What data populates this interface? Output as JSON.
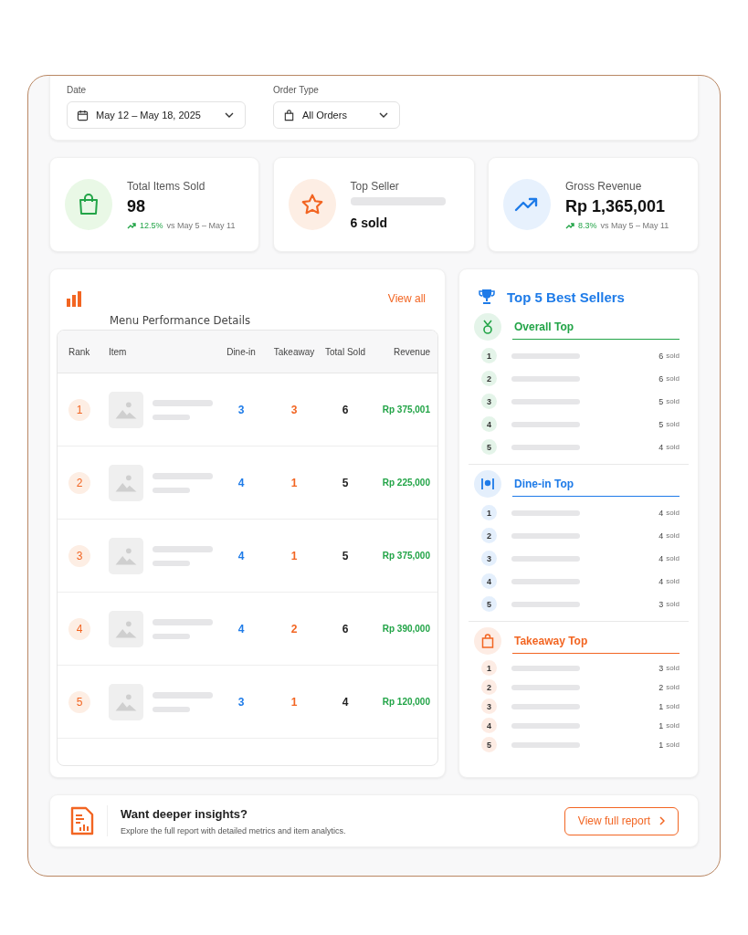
{
  "filters": [
    {
      "kind": "date",
      "label": "Date",
      "value": "May 12 – May 18, 2025"
    },
    {
      "kind": "bag",
      "label": "Order Type",
      "value": "All Orders"
    }
  ],
  "stats": [
    {
      "kind": "items",
      "label": "Total Items Sold",
      "value": "98",
      "change": "12.5%",
      "compare": "vs May 5 – May 11"
    },
    {
      "kind": "top",
      "label": "Top Seller",
      "value": "6 sold"
    },
    {
      "kind": "revenue",
      "label": "Gross Revenue",
      "value": "Rp 1,365,001",
      "change": "8.3%",
      "compare": "vs May 5 – May 11"
    }
  ],
  "performance": {
    "title": "Menu Performance Details",
    "link": "View all",
    "columns": [
      "Rank",
      "Item",
      "Dine-in",
      "Takeaway",
      "Total Sold",
      "Revenue"
    ],
    "rows": [
      {
        "rank": "1",
        "dine_in": "3",
        "takeaway": "3",
        "total": "6",
        "revenue": "Rp 375,001"
      },
      {
        "rank": "2",
        "dine_in": "4",
        "takeaway": "1",
        "total": "5",
        "revenue": "Rp 225,000"
      },
      {
        "rank": "3",
        "dine_in": "4",
        "takeaway": "1",
        "total": "5",
        "revenue": "Rp 375,000"
      },
      {
        "rank": "4",
        "dine_in": "4",
        "takeaway": "2",
        "total": "6",
        "revenue": "Rp 390,000"
      },
      {
        "rank": "5",
        "dine_in": "3",
        "takeaway": "1",
        "total": "4",
        "revenue": "Rp 120,000"
      }
    ]
  },
  "best_sellers": {
    "title": "Top 5 Best Sellers",
    "groups": [
      {
        "kind": "overall",
        "title": "Overall Top",
        "color": "#22a447",
        "items": [
          {
            "rank": "1",
            "count": "6",
            "unit": "sold"
          },
          {
            "rank": "2",
            "count": "6",
            "unit": "sold"
          },
          {
            "rank": "3",
            "count": "5",
            "unit": "sold"
          },
          {
            "rank": "4",
            "count": "5",
            "unit": "sold"
          },
          {
            "rank": "5",
            "count": "4",
            "unit": "sold"
          }
        ]
      },
      {
        "kind": "dine_in",
        "title": "Dine-in Top",
        "color": "#1e7be8",
        "items": [
          {
            "rank": "1",
            "count": "4",
            "unit": "sold"
          },
          {
            "rank": "2",
            "count": "4",
            "unit": "sold"
          },
          {
            "rank": "3",
            "count": "4",
            "unit": "sold"
          },
          {
            "rank": "4",
            "count": "4",
            "unit": "sold"
          },
          {
            "rank": "5",
            "count": "3",
            "unit": "sold"
          }
        ]
      },
      {
        "kind": "takeaway",
        "title": "Takeaway Top",
        "color": "#f26522",
        "items": [
          {
            "rank": "1",
            "count": "3",
            "unit": "sold"
          },
          {
            "rank": "2",
            "count": "2",
            "unit": "sold"
          },
          {
            "rank": "3",
            "count": "1",
            "unit": "sold"
          },
          {
            "rank": "4",
            "count": "1",
            "unit": "sold"
          },
          {
            "rank": "5",
            "count": "1",
            "unit": "sold"
          }
        ]
      }
    ]
  },
  "insight": {
    "title": "Want deeper insights?",
    "text": "Explore the full report with detailed metrics and item analytics.",
    "button": "View full report"
  }
}
